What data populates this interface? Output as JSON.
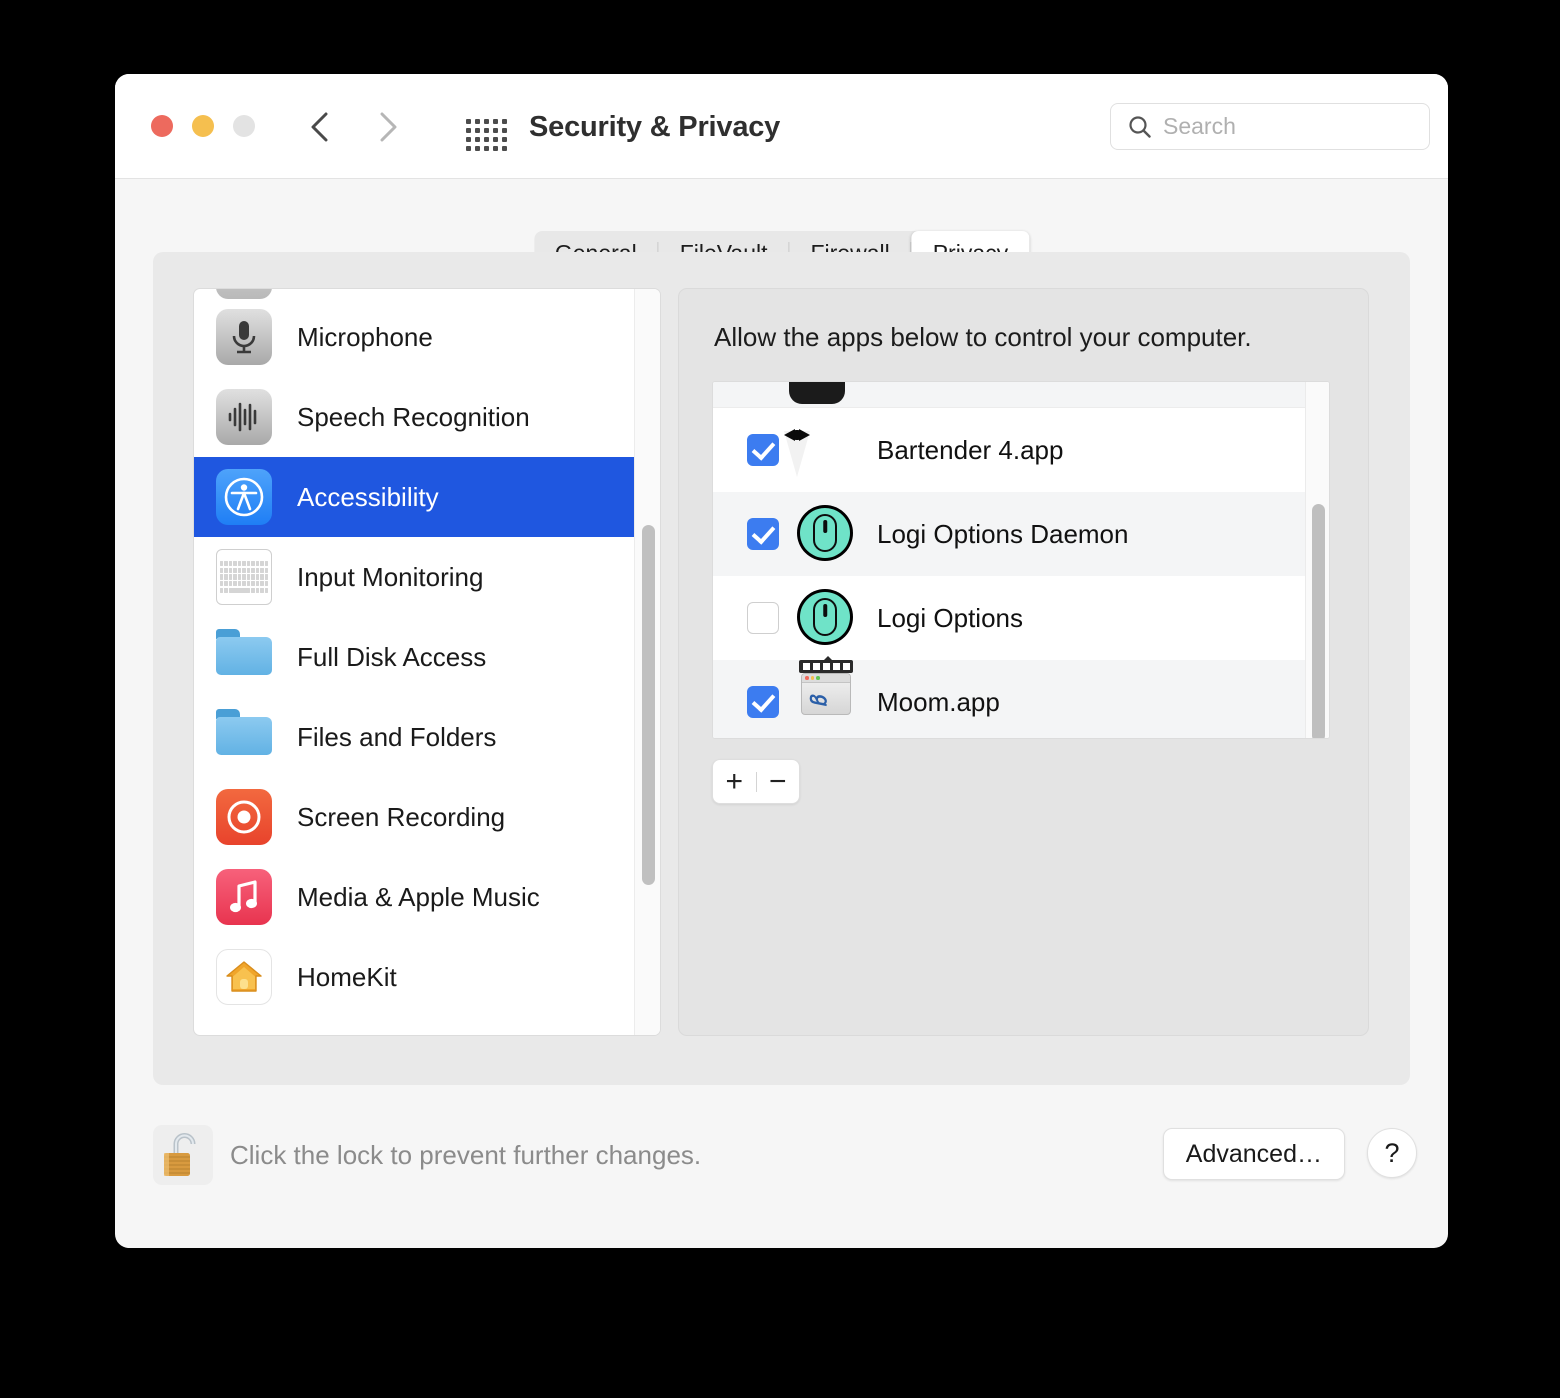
{
  "window": {
    "title": "Security & Privacy",
    "traffic_lights": [
      "close",
      "minimize",
      "zoom"
    ],
    "back_icon": "chevron-left-icon",
    "forward_icon": "chevron-right-icon",
    "grid_icon": "show-all-grid-icon"
  },
  "search": {
    "placeholder": "Search",
    "value": "",
    "icon": "search-icon"
  },
  "tabs": [
    {
      "label": "General",
      "selected": false
    },
    {
      "label": "FileVault",
      "selected": false
    },
    {
      "label": "Firewall",
      "selected": false
    },
    {
      "label": "Privacy",
      "selected": true
    }
  ],
  "sidebar": {
    "items": [
      {
        "label": "Microphone",
        "icon": "microphone-icon",
        "selected": false
      },
      {
        "label": "Speech Recognition",
        "icon": "waveform-icon",
        "selected": false
      },
      {
        "label": "Accessibility",
        "icon": "accessibility-icon",
        "selected": true
      },
      {
        "label": "Input Monitoring",
        "icon": "keyboard-icon",
        "selected": false
      },
      {
        "label": "Full Disk Access",
        "icon": "folder-icon",
        "selected": false
      },
      {
        "label": "Files and Folders",
        "icon": "folder-icon",
        "selected": false
      },
      {
        "label": "Screen Recording",
        "icon": "screen-recording-icon",
        "selected": false
      },
      {
        "label": "Media & Apple Music",
        "icon": "music-note-icon",
        "selected": false
      },
      {
        "label": "HomeKit",
        "icon": "homekit-house-icon",
        "selected": false
      }
    ]
  },
  "right_panel": {
    "heading": "Allow the apps below to control your computer.",
    "apps": [
      {
        "name": "Bartender 4.app",
        "checked": true,
        "icon": "tuxedo-icon"
      },
      {
        "name": "Logi Options Daemon",
        "checked": true,
        "icon": "logi-mouse-icon"
      },
      {
        "name": "Logi Options",
        "checked": false,
        "icon": "logi-mouse-icon"
      },
      {
        "name": "Moom.app",
        "checked": true,
        "icon": "moom-window-icon"
      }
    ],
    "add_label": "+",
    "remove_label": "−"
  },
  "bottom": {
    "lock_icon": "unlocked-padlock-icon",
    "lock_text": "Click the lock to prevent further changes.",
    "advanced_label": "Advanced…",
    "help_label": "?"
  },
  "colors": {
    "accent_blue": "#1f57e0",
    "checkbox_blue": "#3c7cf0",
    "window_bg": "#f6f6f6",
    "panel_bg": "#e9e9e9",
    "desktop_bg": "#000000"
  }
}
